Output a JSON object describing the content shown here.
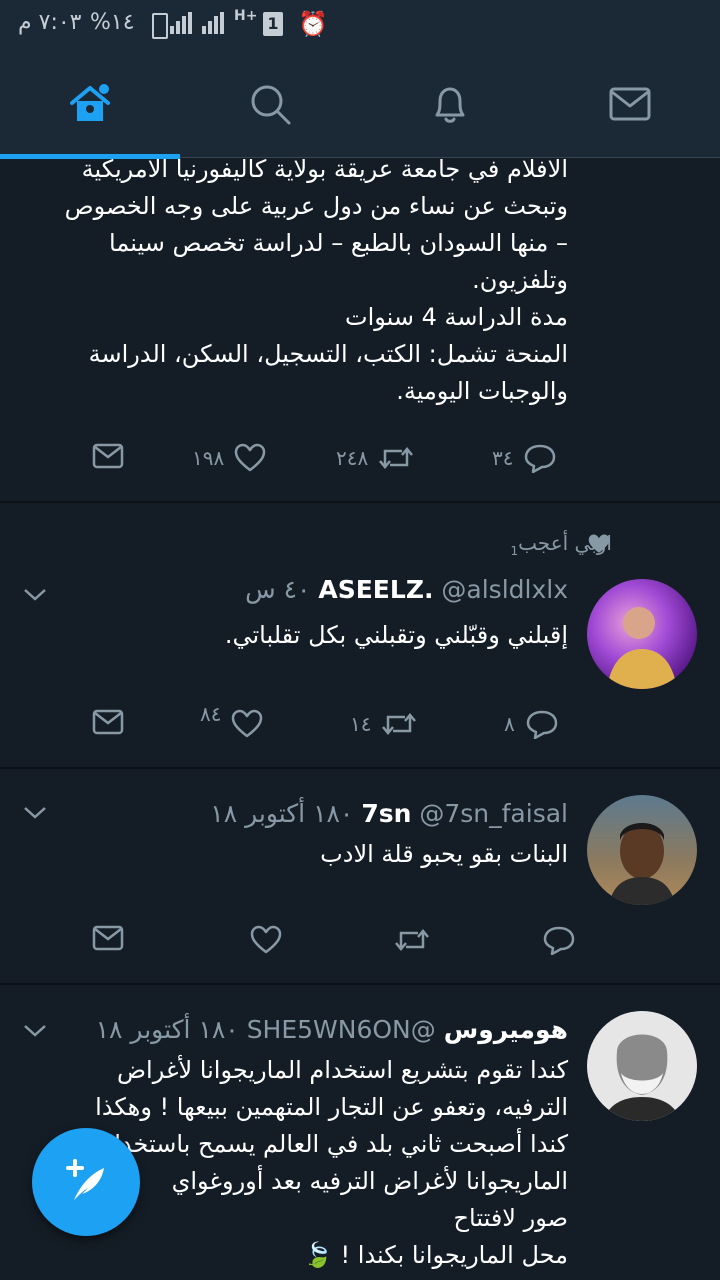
{
  "status_bar": {
    "time": "٧:٠٣ م",
    "battery": "%١٤",
    "sim_slot": "1",
    "network": "H+"
  },
  "nav": {
    "tabs": [
      {
        "name": "home",
        "icon": "home-icon",
        "active": true
      },
      {
        "name": "search",
        "icon": "search-icon",
        "active": false
      },
      {
        "name": "notifications",
        "icon": "bell-icon",
        "active": false
      },
      {
        "name": "messages",
        "icon": "mail-icon",
        "active": false
      }
    ],
    "accent": "#1da1f2"
  },
  "tweets": [
    {
      "text_lines": [
        "الافلام في جامعة عريقة بولاية كاليفورنيا الامريكية",
        "وتبحث عن نساء من دول عربية على وجه الخصوص",
        "– منها السودان بالطبع – لدراسة تخصص سينما",
        "وتلفزيون.",
        "مدة الدراسة 4 سنوات",
        "المنحة تشمل: الكتب، التسجيل، السكن، الدراسة",
        "والوجبات اليومية."
      ],
      "replies": "٣٤",
      "retweets": "٢٤٨",
      "likes": "١٩٨"
    },
    {
      "context": "اوبي أعجب",
      "context_badge": "1",
      "name": "ASEELZ.",
      "handle": "@alsldlxlx",
      "time": "٤٠ س",
      "text": "إقبلني وقبّلني وتقبلني بكل تقلباتي.",
      "replies": "٨",
      "retweets": "١٤",
      "likes": "٨٤"
    },
    {
      "name": "7sn",
      "handle": "@7sn_faisal",
      "time": "١٨٠ أكتوبر ١٨",
      "text": "البنات بقو يحبو قلة الادب",
      "replies": "",
      "retweets": "",
      "likes": ""
    },
    {
      "name": "هوميروس",
      "handle": "@SHE5WN6ON",
      "time": "١٨٠ أكتوبر ١٨",
      "text_lines": [
        "كندا تقوم بتشريع استخدام الماريجوانا لأغراض",
        "الترفيه، وتعفو عن التجار المتهمين ببيعها ! وهكذا",
        "كندا أصبحت ثاني بلد في العالم يسمح باستخدام",
        "الماريجوانا لأغراض الترفيه بعد أوروغواي",
        "صور لافتتاح",
        "محل الماريجوانا بكندا ! 🍃"
      ]
    }
  ]
}
